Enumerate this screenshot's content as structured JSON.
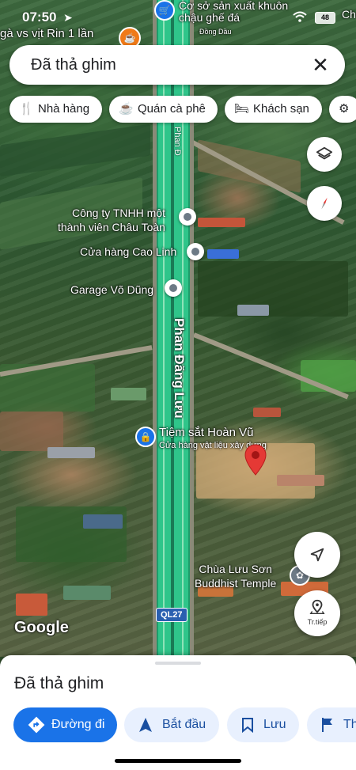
{
  "status_bar": {
    "time": "07:50",
    "battery": "48"
  },
  "map": {
    "top_labels": {
      "left_poi": "gà vs vịt Rin 1 lần",
      "top_poi": "Cơ sở sản xuất khuôn chậu ghế đá",
      "right_edge": "Ch",
      "small_road": "Đồng Dầu"
    },
    "road_name": "Phan Đăng Lưu",
    "road_name_top": "Phan Đ",
    "highway_badge": "QL27",
    "pois": [
      {
        "name": "Công ty TNHH một thành viên Châu Toàn",
        "line1": "Công ty TNHH một",
        "line2": "thành viên Châu Toàn"
      },
      {
        "name": "Cửa hàng Cao Linh"
      },
      {
        "name": "Garage Võ Dũng"
      },
      {
        "name": "Tiệm sắt Hoàn Vũ",
        "subtitle": "Cửa hàng vật liệu xây dựng"
      },
      {
        "name": "Chùa Lưu Sơn Buddhist Temple",
        "line1": "Chùa Lưu Sơn",
        "line2": "Buddhist Temple"
      }
    ],
    "google_logo": "Google",
    "street_view_label": "Tr.tiếp"
  },
  "search": {
    "query": "Đã thả ghim"
  },
  "chips": [
    {
      "label": "Nhà hàng",
      "icon": "restaurant-icon"
    },
    {
      "label": "Quán cà phê",
      "icon": "coffee-icon"
    },
    {
      "label": "Khách sạn",
      "icon": "hotel-icon"
    },
    {
      "label": "",
      "icon": "attractions-icon"
    }
  ],
  "sheet": {
    "title": "Đã thả ghim",
    "actions": [
      {
        "label": "Đường đi",
        "icon": "directions-icon"
      },
      {
        "label": "Bắt đầu",
        "icon": "navigation-icon"
      },
      {
        "label": "Lưu",
        "icon": "bookmark-icon"
      },
      {
        "label": "Th",
        "icon": "flag-icon"
      }
    ]
  },
  "colors": {
    "accent": "#1a73e8",
    "pin": "#e53935",
    "route": "#2fc58a"
  }
}
